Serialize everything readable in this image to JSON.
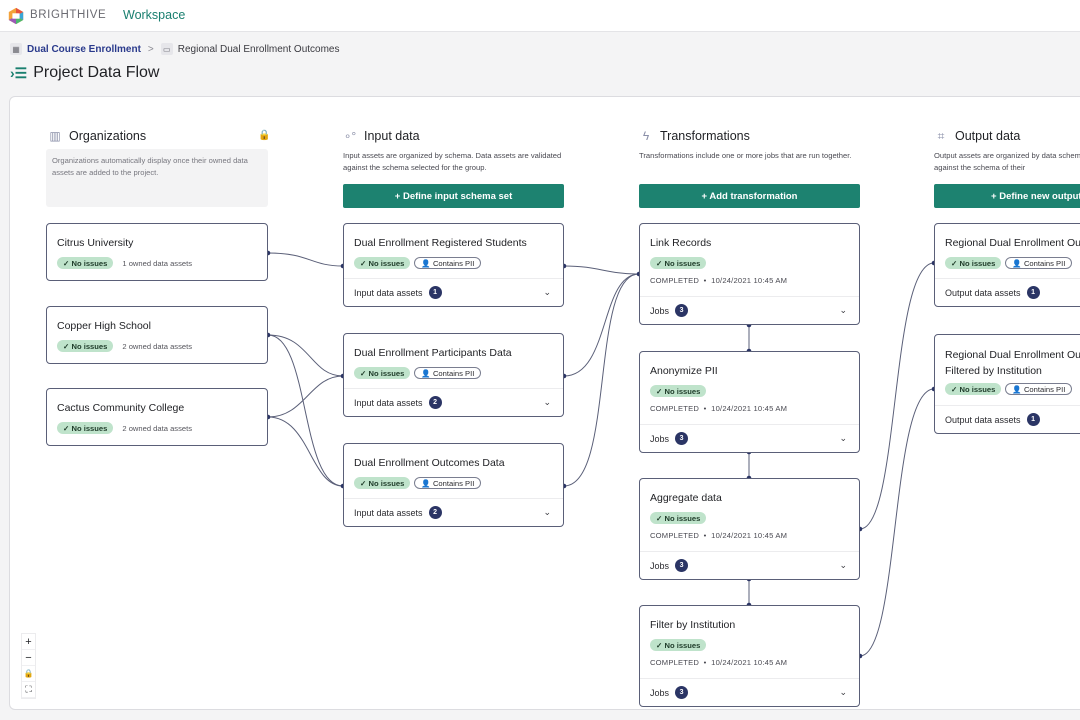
{
  "header": {
    "brand": "BRIGHTHIVE",
    "nav_workspace": "Workspace",
    "logo_icon": "brighthive-hexagon-logo"
  },
  "breadcrumb": {
    "items": [
      {
        "label": "Dual Course Enrollment",
        "icon": "grid-icon"
      },
      {
        "label": "Regional Dual Enrollment Outcomes",
        "icon": "folder-icon"
      }
    ],
    "separator": ">"
  },
  "page": {
    "title": "Project Data Flow",
    "title_icon": "flow-list-icon"
  },
  "columns": {
    "organizations": {
      "title": "Organizations",
      "icon": "building-icon",
      "locked": true,
      "info": "Organizations automatically display once their owned data assets are added to the project.",
      "items": [
        {
          "name": "Citrus University",
          "status": "No issues",
          "owned": "1 owned data assets"
        },
        {
          "name": "Copper High School",
          "status": "No issues",
          "owned": "2 owned data assets"
        },
        {
          "name": "Cactus Community College",
          "status": "No issues",
          "owned": "2 owned data assets"
        }
      ]
    },
    "input": {
      "title": "Input data",
      "icon": "bubbles-icon",
      "description": "Input assets are organized by schema. Data assets are validated against the schema selected for the group.",
      "button": "+ Define input schema set",
      "items": [
        {
          "name": "Dual Enrollment Registered Students",
          "status": "No issues",
          "pii": "Contains PII",
          "footer": "Input data assets",
          "count": "1"
        },
        {
          "name": "Dual Enrollment Participants Data",
          "status": "No issues",
          "pii": "Contains PII",
          "footer": "Input data assets",
          "count": "2"
        },
        {
          "name": "Dual Enrollment Outcomes Data",
          "status": "No issues",
          "pii": "Contains PII",
          "footer": "Input data assets",
          "count": "2"
        }
      ]
    },
    "transformations": {
      "title": "Transformations",
      "icon": "lightning-icon",
      "description": "Transformations include one or more jobs that are run together.",
      "button": "+ Add transformation",
      "items": [
        {
          "name": "Link Records",
          "status": "No issues",
          "state": "COMPLETED",
          "timestamp": "10/24/2021 10:45 AM",
          "footer": "Jobs",
          "count": "3"
        },
        {
          "name": "Anonymize PII",
          "status": "No issues",
          "state": "COMPLETED",
          "timestamp": "10/24/2021 10:45 AM",
          "footer": "Jobs",
          "count": "3"
        },
        {
          "name": "Aggregate data",
          "status": "No issues",
          "state": "COMPLETED",
          "timestamp": "10/24/2021 10:45 AM",
          "footer": "Jobs",
          "count": "3"
        },
        {
          "name": "Filter by Institution",
          "status": "No issues",
          "state": "COMPLETED",
          "timestamp": "10/24/2021 10:45 AM",
          "footer": "Jobs",
          "count": "3"
        }
      ]
    },
    "output": {
      "title": "Output data",
      "icon": "frame-icon",
      "description": "Output assets are organized by data schema and are validated against the schema of their",
      "button": "+ Define new output set",
      "items": [
        {
          "name": "Regional Dual Enrollment Outcomes",
          "status": "No issues",
          "pii": "Contains PII",
          "footer": "Output data assets",
          "count": "1"
        },
        {
          "name": "Regional Dual Enrollment Outcomes Filtered by Institution",
          "status": "No issues",
          "pii": "Contains PII",
          "footer": "Output data assets",
          "count": "1"
        }
      ]
    }
  },
  "zoom_controls": {
    "zoom_in": "+",
    "zoom_out": "−",
    "lock": "🔒",
    "fit": "⛶"
  },
  "colors": {
    "accent": "#1d8270",
    "badge_ok": "#bfe3cb",
    "edge": "#5a5f78",
    "count_badge": "#2b3565"
  }
}
